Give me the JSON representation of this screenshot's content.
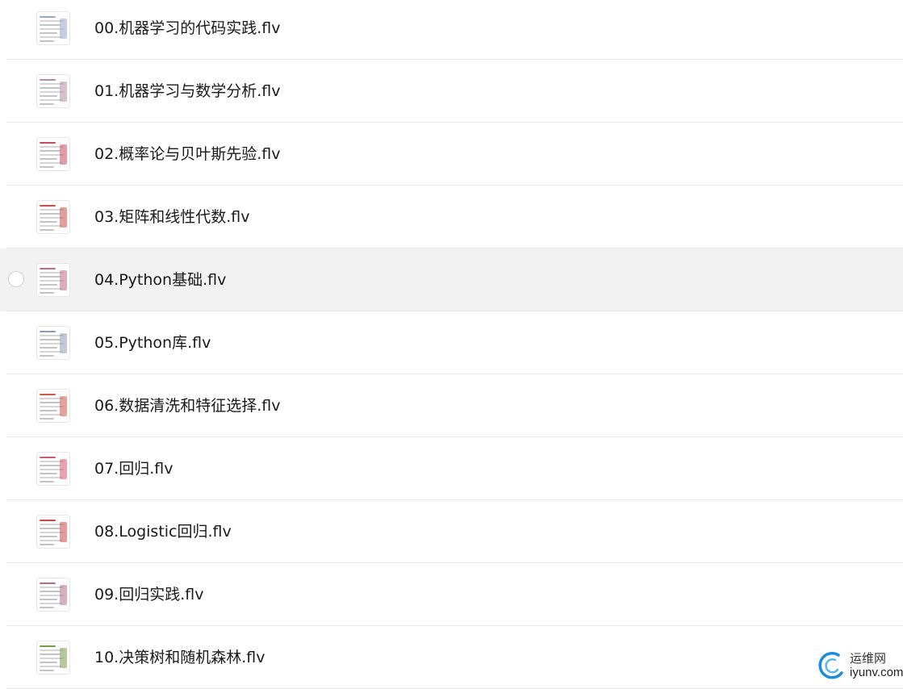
{
  "files": [
    {
      "name": "00.机器学习的代码实践.flv",
      "selected": false,
      "thumb": "#9aa6c8"
    },
    {
      "name": "01.机器学习与数学分析.flv",
      "selected": false,
      "thumb": "#b48aa8"
    },
    {
      "name": "02.概率论与贝叶斯先验.flv",
      "selected": false,
      "thumb": "#c94c5e"
    },
    {
      "name": "03.矩阵和线性代数.flv",
      "selected": false,
      "thumb": "#c8504a"
    },
    {
      "name": "04.Python基础.flv",
      "selected": true,
      "thumb": "#c06a8a"
    },
    {
      "name": "05.Python库.flv",
      "selected": false,
      "thumb": "#8f9ab8"
    },
    {
      "name": "06.数据清洗和特征选择.flv",
      "selected": false,
      "thumb": "#d0584c"
    },
    {
      "name": "07.回归.flv",
      "selected": false,
      "thumb": "#d05a70"
    },
    {
      "name": "08.Logistic回归.flv",
      "selected": false,
      "thumb": "#c84a4a"
    },
    {
      "name": "09.回归实践.flv",
      "selected": false,
      "thumb": "#b0708c"
    },
    {
      "name": "10.决策树和随机森林.flv",
      "selected": false,
      "thumb": "#7a9a4a"
    }
  ],
  "watermark": {
    "title": "运维网",
    "domain": "iyunv.com",
    "color": "#1a8fd6"
  }
}
